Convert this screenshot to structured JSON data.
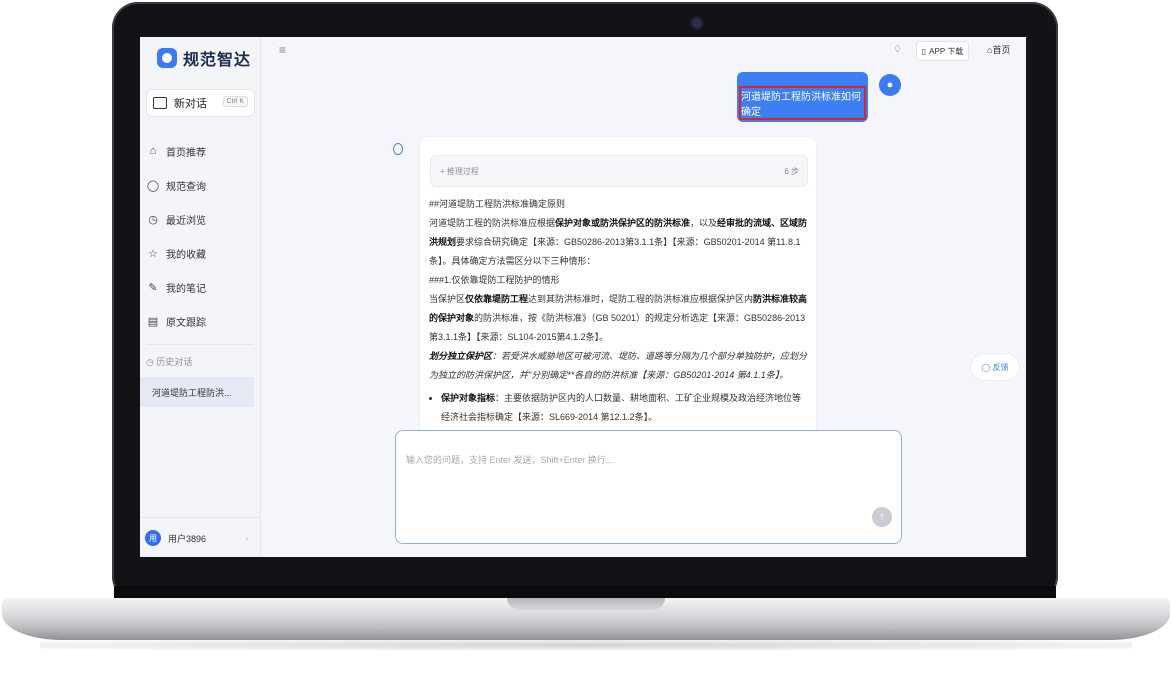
{
  "sidebar": {
    "brand": "规范智达",
    "new_chat": {
      "label": "新对话",
      "shortcut": "Ctrl K"
    },
    "nav": [
      {
        "icon": "home-icon",
        "label": "首页推荐"
      },
      {
        "icon": "search-icon",
        "label": "规范查询"
      },
      {
        "icon": "clock-icon",
        "label": "最近浏览"
      },
      {
        "icon": "star-icon",
        "label": "我的收藏"
      },
      {
        "icon": "note-icon",
        "label": "我的笔记"
      },
      {
        "icon": "document-icon",
        "label": "原文跟踪"
      }
    ],
    "history_label": "历史对话",
    "history": [
      {
        "label": "河道堤防工程防洪..."
      }
    ],
    "user": {
      "avatar_text": "用",
      "name": "用户3896"
    }
  },
  "header": {
    "app_download": "APP 下载",
    "home": "首页"
  },
  "chat": {
    "user_message": "河道堤防工程防洪标准如何确定",
    "reasoning": {
      "label": "推理过程",
      "steps": "6 步"
    },
    "answer": {
      "heading": "##河道堤防工程防洪标准确定原则",
      "p1_a": "河道堤防工程的防洪标准应根据",
      "p1_b": "保护对象或防洪保护区的防洪标准",
      "p1_c": "，以及",
      "p1_d": "经审批的流域、区域防洪规划",
      "p1_e": "要求综合研究确定【来源：GB50286-2013第3.1.1条】【来源：GB50201-2014 第11.8.1条】。具体确定方法需区分以下三种情形：",
      "subheading": "###1.仅依靠堤防工程防护的情形",
      "p2_a": "当保护区",
      "p2_b": "仅依靠堤防工程",
      "p2_c": "达到其防洪标准时，堤防工程的防洪标准应根据保护区内",
      "p2_d": "防洪标准较高的保护对象",
      "p2_e": "的防洪标准，按《防洪标准》（GB 50201）的规定分析选定【来源：GB50286-2013第3.1.1条】【来源：SL104-2015第4.1.2条】。",
      "p3_a": "划分独立保护区",
      "p3_b": "：若受洪水威胁地区可被河流、堤防、道路等分隔为几个部分单独防护，应划分为独立的防洪保护区，并\"分别确定**各自的防洪标准【来源：GB50201-2014 第4.1.1条】。",
      "bullet_a": "保护对象指标",
      "bullet_b": "：主要依据防护区内的人口数量、耕地面积、工矿企业规模及政治经济地位等经济社会指标确定【来源：SL669-2014 第12.1.2条】。"
    },
    "feedback": "反馈",
    "input_placeholder": "输入您的问题，支持 Enter 发送，Shift+Enter 换行..."
  }
}
